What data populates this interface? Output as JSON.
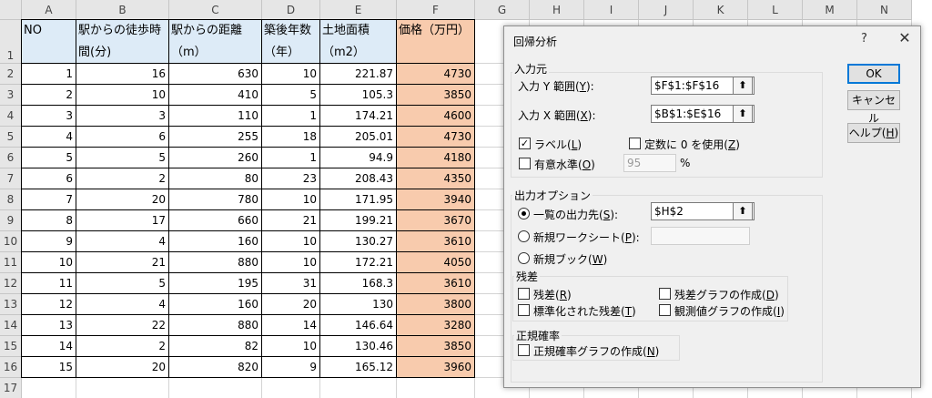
{
  "columns": [
    "A",
    "B",
    "C",
    "D",
    "E",
    "F",
    "G",
    "H",
    "I",
    "J",
    "K",
    "L",
    "M",
    "N"
  ],
  "rows": [
    "1",
    "2",
    "3",
    "4",
    "5",
    "6",
    "7",
    "8",
    "9",
    "10",
    "11",
    "12",
    "13",
    "14",
    "15",
    "16",
    "17"
  ],
  "table": {
    "headers": [
      {
        "l1": "NO",
        "l2": ""
      },
      {
        "l1": "駅からの徒歩時",
        "l2": "間(分)"
      },
      {
        "l1": "駅からの距離",
        "l2": "（m）"
      },
      {
        "l1": "築後年数",
        "l2": "（年）"
      },
      {
        "l1": "土地面積",
        "l2": "（m2）"
      },
      {
        "l1": "価格（万円）",
        "l2": ""
      }
    ],
    "data": [
      [
        "1",
        "16",
        "630",
        "10",
        "221.87",
        "4730"
      ],
      [
        "2",
        "10",
        "410",
        "5",
        "105.3",
        "3850"
      ],
      [
        "3",
        "3",
        "110",
        "1",
        "174.21",
        "4600"
      ],
      [
        "4",
        "6",
        "255",
        "18",
        "205.01",
        "4730"
      ],
      [
        "5",
        "5",
        "260",
        "1",
        "94.9",
        "4180"
      ],
      [
        "6",
        "2",
        "80",
        "23",
        "208.43",
        "4350"
      ],
      [
        "7",
        "20",
        "780",
        "10",
        "171.95",
        "3940"
      ],
      [
        "8",
        "17",
        "660",
        "21",
        "199.21",
        "3670"
      ],
      [
        "9",
        "4",
        "160",
        "10",
        "130.27",
        "3610"
      ],
      [
        "10",
        "21",
        "880",
        "10",
        "172.21",
        "4050"
      ],
      [
        "11",
        "5",
        "195",
        "31",
        "168.3",
        "3610"
      ],
      [
        "12",
        "4",
        "160",
        "20",
        "130",
        "3800"
      ],
      [
        "13",
        "22",
        "880",
        "14",
        "146.64",
        "3280"
      ],
      [
        "14",
        "2",
        "82",
        "10",
        "130.46",
        "3850"
      ],
      [
        "15",
        "20",
        "820",
        "9",
        "165.12",
        "3960"
      ]
    ]
  },
  "dialog": {
    "title": "回帰分析",
    "help_icon": "?",
    "close_icon": "✕",
    "input_group": "入力元",
    "y_label": "入力 Y 範囲(",
    "y_key": "Y",
    "y_end": "):",
    "y_value": "$F$1:$F$16",
    "x_label": "入力 X 範囲(",
    "x_key": "X",
    "x_end": "):",
    "x_value": "$B$1:$E$16",
    "ref_icon": "⬆",
    "label_chk": "ラベル(",
    "label_key": "L",
    "label_end": ")",
    "label_checked": "✓",
    "const_chk": "定数に 0 を使用(",
    "const_key": "Z",
    "const_end": ")",
    "conf_chk": "有意水準(",
    "conf_key": "O",
    "conf_end": ")",
    "conf_value": "95",
    "conf_unit": "%",
    "output_group": "出力オプション",
    "out_range": "一覧の出力先(",
    "out_range_key": "S",
    "out_range_end": "):",
    "out_range_value": "$H$2",
    "new_sheet": "新規ワークシート(",
    "new_sheet_key": "P",
    "new_sheet_end": "):",
    "new_book": "新規ブック(",
    "new_book_key": "W",
    "new_book_end": ")",
    "resid_group": "残差",
    "resid": "残差(",
    "resid_key": "R",
    "resid_end": ")",
    "std_resid": "標準化された残差(",
    "std_resid_key": "T",
    "std_resid_end": ")",
    "resid_plot": "残差グラフの作成(",
    "resid_plot_key": "D",
    "resid_plot_end": ")",
    "line_fit": "観測値グラフの作成(",
    "line_fit_key": "I",
    "line_fit_end": ")",
    "normal_group": "正規確率",
    "normal_plot": "正規確率グラフの作成(",
    "normal_plot_key": "N",
    "normal_plot_end": ")",
    "ok": "OK",
    "cancel": "キャンセル",
    "help": "ヘルプ(",
    "help_key": "H",
    "help_end": ")"
  }
}
